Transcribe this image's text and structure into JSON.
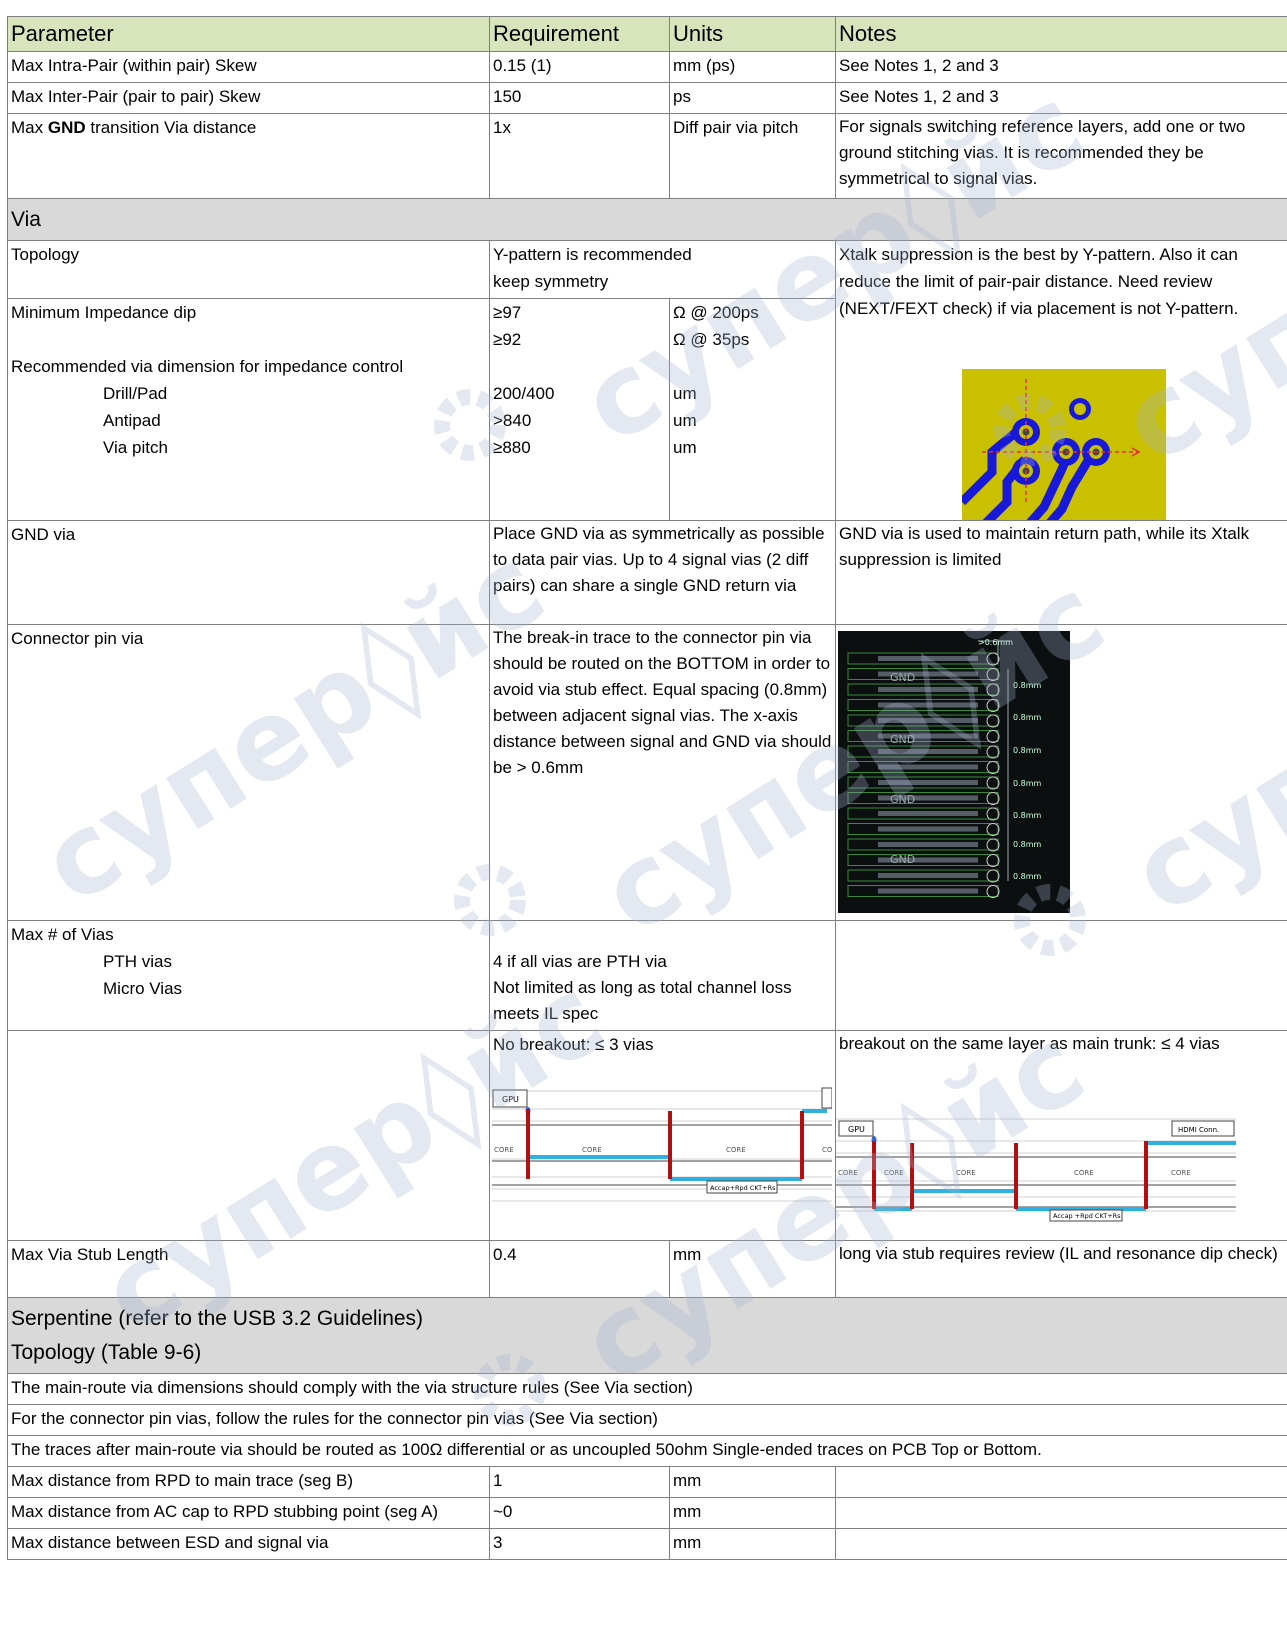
{
  "headers": {
    "parameter": "Parameter",
    "requirement": "Requirement",
    "units": "Units",
    "notes": "Notes"
  },
  "rows_top": [
    {
      "p": "Max Intra-Pair (within pair) Skew",
      "r": "0.15 (1)",
      "u": "mm (ps)",
      "n": "See Notes  1, 2 and 3"
    },
    {
      "p": "Max Inter-Pair (pair to pair) Skew",
      "r": "150",
      "u": "ps",
      "n": "See Notes  1, 2 and 3"
    }
  ],
  "gnd_transition": {
    "pre": "Max ",
    "bold": "GND",
    "post": " transition Via distance",
    "r": "1x",
    "u": "Diff pair via pitch",
    "n": "For signals switching reference layers, add one or two ground stitching vias. It is recommended they be symmetrical to signal vias."
  },
  "via_section": "Via",
  "topology": {
    "p": "Topology",
    "r1": "Y-pattern is recommended",
    "r2": "keep symmetry",
    "n": "Xtalk suppression is the best by Y-pattern. Also it can reduce the limit of pair-pair distance. Need review (NEXT/FEXT check) if via placement is not Y-pattern."
  },
  "impedance": {
    "p": "Minimum Impedance dip",
    "r1": "≥97",
    "u1": "Ω @ 200ps",
    "r2": "≥92",
    "u2": "Ω @ 35ps",
    "rec": "Recommended via dimension for impedance control",
    "items": [
      {
        "p": "Drill/Pad",
        "r": "200/400",
        "u": "um"
      },
      {
        "p": "Antipad",
        "r": ">840",
        "u": "um"
      },
      {
        "p": "Via pitch",
        "r": "≥880",
        "u": "um"
      }
    ]
  },
  "gnd_via": {
    "p": "GND via",
    "r": "Place GND via as symmetrically as possible to data pair vias.  Up to 4 signal vias (2 diff pairs) can share a single GND return via",
    "n": "GND via is used to maintain return path, while its Xtalk suppression is limited"
  },
  "conn_via": {
    "p": "Connector pin via",
    "r": "The break-in trace to the connector pin via should be routed on the BOTTOM in order to avoid via stub effect. Equal spacing (0.8mm) between adjacent signal vias. The x-axis distance between signal and GND via should be > 0.6mm",
    "img": {
      "top_dim": ">0.6mm",
      "gnd": "GND",
      "spacing": "0.8mm"
    }
  },
  "max_vias": {
    "p": "Max # of Vias",
    "pth": "PTH vias",
    "micro": "Micro Vias",
    "r_pth": "4 if all vias are PTH via",
    "r_micro": "Not limited as long as total channel loss meets IL spec"
  },
  "breakout": {
    "r": "No breakout: ≤ 3 vias",
    "n": "breakout on the same layer as main trunk: ≤ 4 vias",
    "diag_left": {
      "gpu": "GPU",
      "core": "CORE",
      "accap": "Accap+Rpd CKT+Rs"
    },
    "diag_right": {
      "gpu": "GPU",
      "hdmi": "HDMI Conn.",
      "core": "CORE",
      "accap": "Accap +Rpd CKT+Rs"
    }
  },
  "stub": {
    "p": "Max Via Stub Length",
    "r": "0.4",
    "u": "mm",
    "n": "long via stub requires review (IL and resonance dip check)"
  },
  "serp_section": {
    "l1": "Serpentine (refer to the USB 3.2 Guidelines)",
    "l2": "Topology (Table 9-6)"
  },
  "notes_full": [
    "The main-route via dimensions should comply with the via structure rules (See Via section)",
    "For the connector pin vias, follow the rules for the connector pin vias (See Via section)",
    "The traces after main-route via should be routed as 100Ω differential or as uncoupled 50ohm Single-ended traces on PCB Top or Bottom."
  ],
  "rows_bottom": [
    {
      "p": "Max distance from RPD to main trace (seg B)",
      "r": "1",
      "u": "mm",
      "n": ""
    },
    {
      "p": "Max distance from AC cap to RPD stubbing point (seg A)",
      "r": "~0",
      "u": "mm",
      "n": ""
    },
    {
      "p": "Max distance between ESD and signal via",
      "r": "3",
      "u": "mm",
      "n": ""
    }
  ],
  "watermark": "супер◊йс",
  "colors": {
    "header_bg": "#d8e4bc",
    "section_bg": "#d9d9d9",
    "border": "#7f7f7f",
    "pcb_yellow": "#c8c000",
    "via_blue": "#1818d8",
    "trace_blue": "#2eb0e0",
    "via_red": "#c00000"
  }
}
